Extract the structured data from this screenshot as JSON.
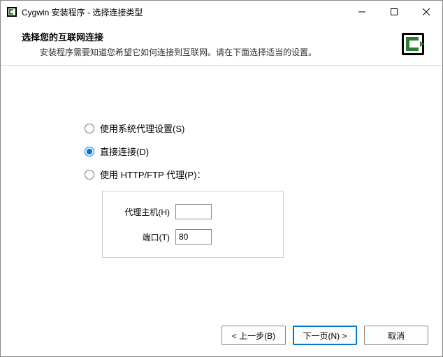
{
  "titlebar": {
    "title": "Cygwin 安装程序 - 选择连接类型"
  },
  "header": {
    "title": "选择您的互联网连接",
    "subtitle": "安装程序需要知道您希望它如何连接到互联网。请在下面选择适当的设置。"
  },
  "options": {
    "system_proxy": "使用系统代理设置(S)",
    "direct": "直接连接(D)",
    "http_proxy": "使用 HTTP/FTP 代理(P)："
  },
  "proxy": {
    "host_label": "代理主机(H)",
    "host_value": "",
    "port_label": "端口(T)",
    "port_value": "80"
  },
  "footer": {
    "back": "< 上一步(B)",
    "next": "下一页(N) >",
    "cancel": "取消"
  }
}
